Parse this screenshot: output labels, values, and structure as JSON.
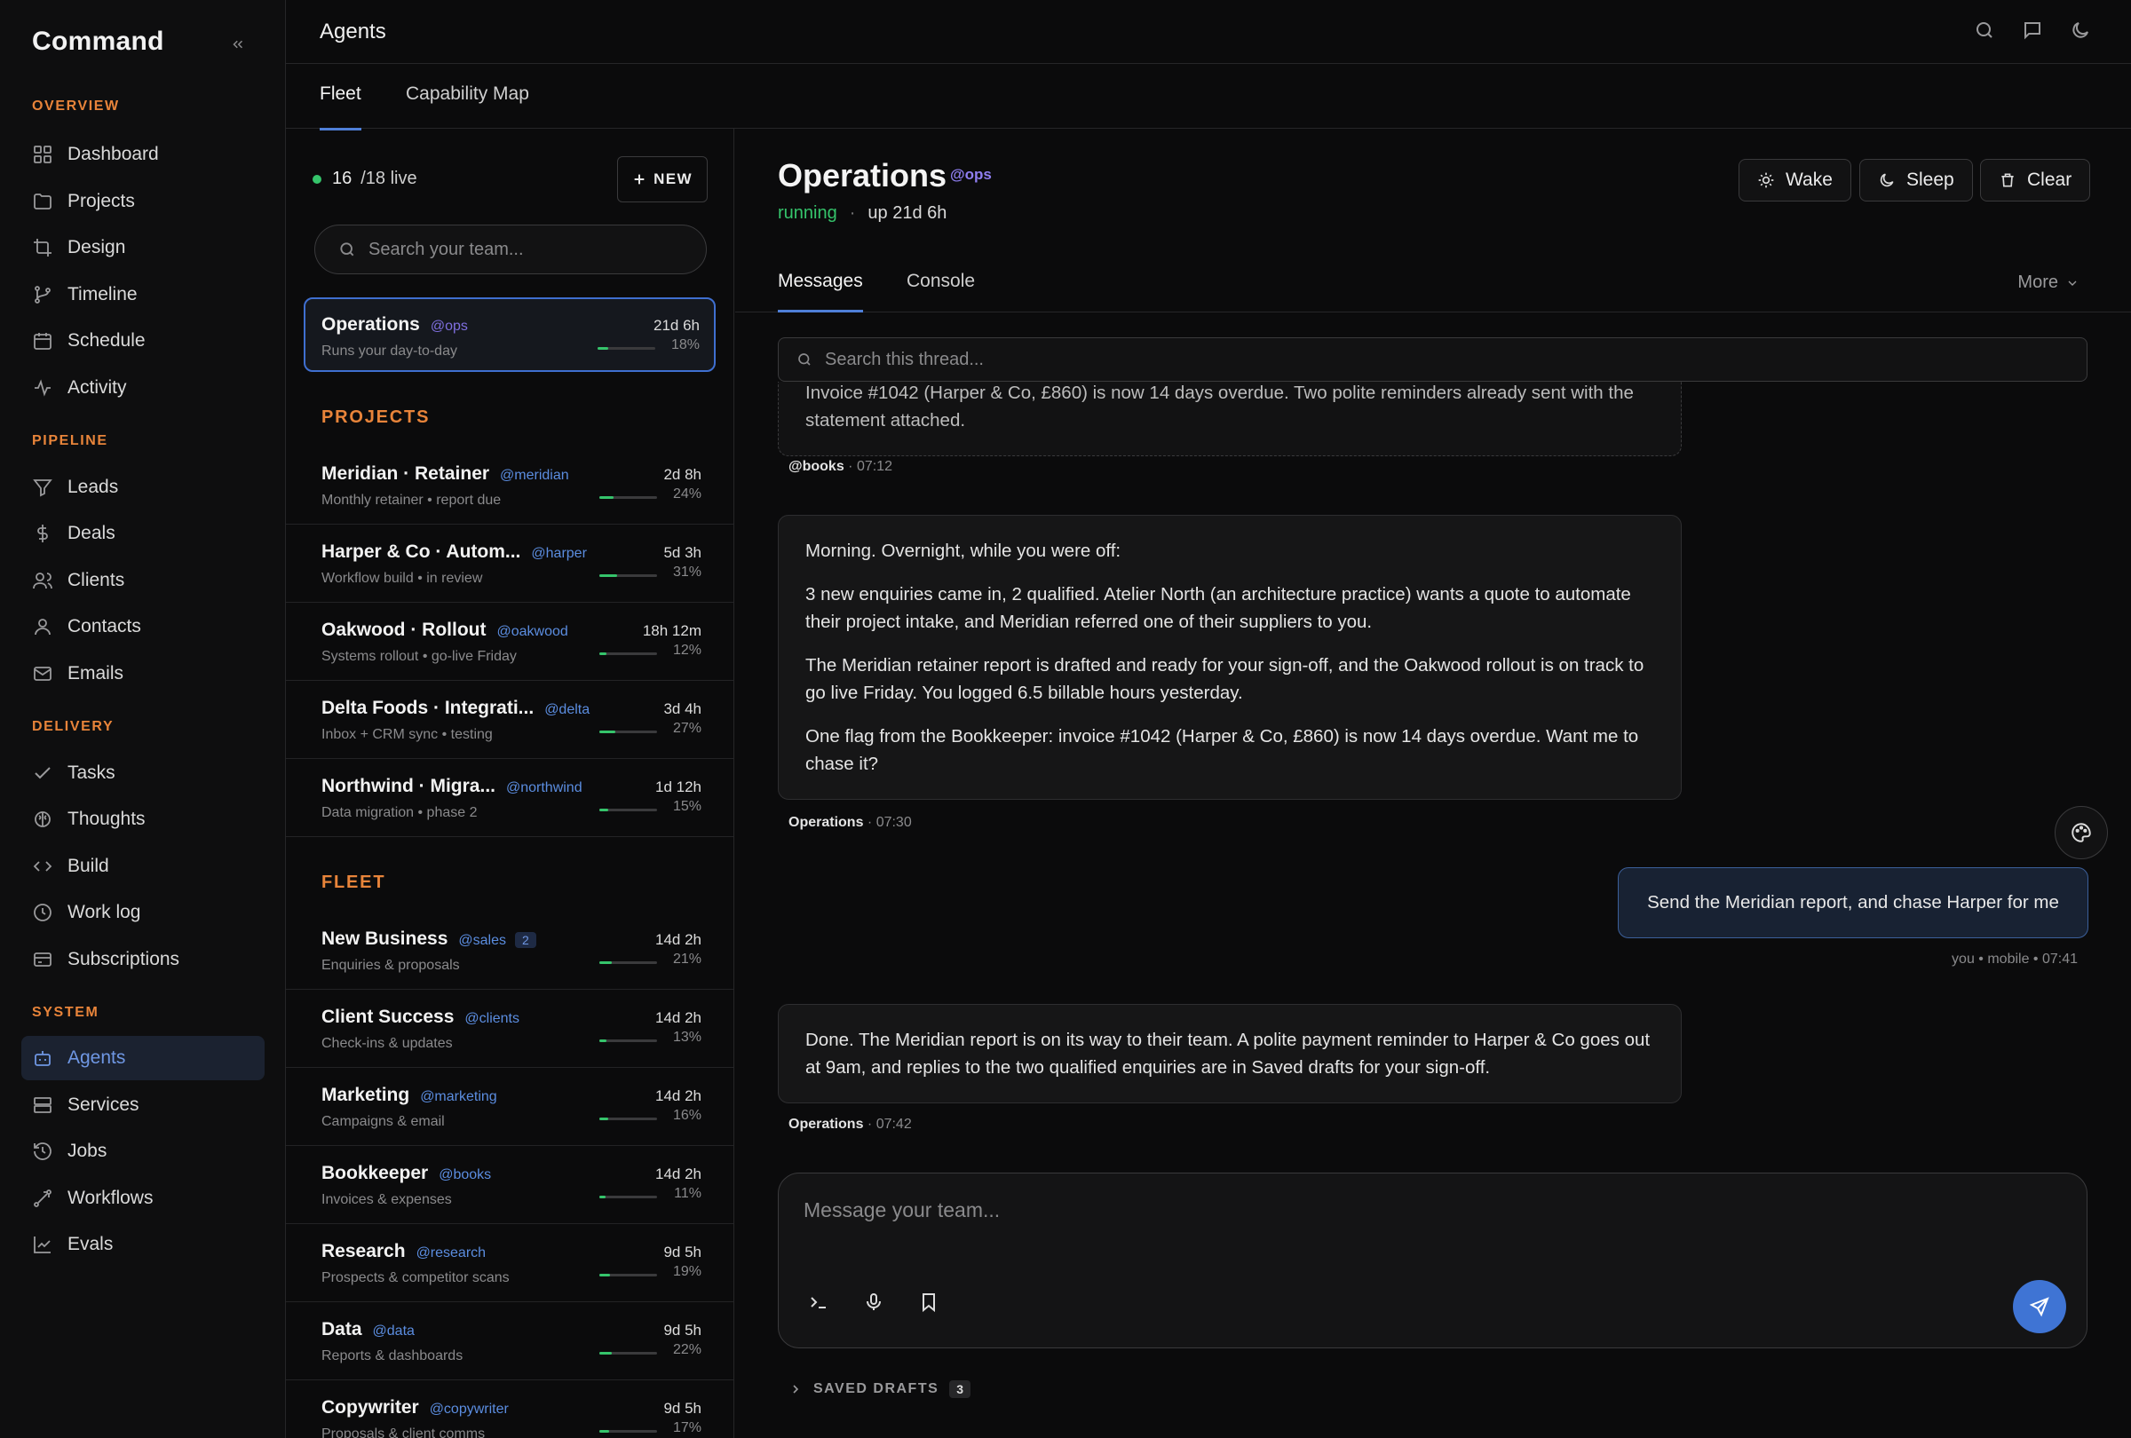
{
  "app": {
    "brand": "Command"
  },
  "sidebar": {
    "sections": [
      {
        "title": "OVERVIEW",
        "items": [
          {
            "label": "Dashboard",
            "icon": "grid-icon"
          },
          {
            "label": "Projects",
            "icon": "folder-icon"
          },
          {
            "label": "Design",
            "icon": "crop-icon"
          },
          {
            "label": "Timeline",
            "icon": "git-branch-icon"
          },
          {
            "label": "Schedule",
            "icon": "calendar-icon"
          },
          {
            "label": "Activity",
            "icon": "activity-icon"
          }
        ]
      },
      {
        "title": "PIPELINE",
        "items": [
          {
            "label": "Leads",
            "icon": "filter-icon"
          },
          {
            "label": "Deals",
            "icon": "dollar-icon"
          },
          {
            "label": "Clients",
            "icon": "users-icon"
          },
          {
            "label": "Contacts",
            "icon": "user-icon"
          },
          {
            "label": "Emails",
            "icon": "mail-icon"
          }
        ]
      },
      {
        "title": "DELIVERY",
        "items": [
          {
            "label": "Tasks",
            "icon": "check-icon"
          },
          {
            "label": "Thoughts",
            "icon": "brain-icon"
          },
          {
            "label": "Build",
            "icon": "code-icon"
          },
          {
            "label": "Work log",
            "icon": "clock-icon"
          },
          {
            "label": "Subscriptions",
            "icon": "card-icon"
          }
        ]
      },
      {
        "title": "SYSTEM",
        "items": [
          {
            "label": "Agents",
            "icon": "bot-icon",
            "active": true
          },
          {
            "label": "Services",
            "icon": "server-icon"
          },
          {
            "label": "Jobs",
            "icon": "history-icon"
          },
          {
            "label": "Workflows",
            "icon": "workflow-icon"
          },
          {
            "label": "Evals",
            "icon": "chart-icon"
          }
        ]
      }
    ]
  },
  "header": {
    "title": "Agents"
  },
  "tabs": [
    "Fleet",
    "Capability Map"
  ],
  "fleet": {
    "live_count": "16",
    "live_total": "/18 live",
    "new_label": "NEW",
    "search_placeholder": "Search your team...",
    "selected": {
      "name": "Operations",
      "handle": "@ops",
      "sub": "Runs your day-to-day",
      "time": "21d 6h",
      "pct": "18%",
      "progress": 0.18
    },
    "projects_title": "PROJECTS",
    "projects": [
      {
        "name": "Meridian · Retainer",
        "handle": "@meridian",
        "sub": "Monthly retainer • report due",
        "time": "2d 8h",
        "pct": "24%",
        "progress": 0.24
      },
      {
        "name": "Harper & Co · Autom...",
        "handle": "@harper",
        "sub": "Workflow build • in review",
        "time": "5d 3h",
        "pct": "31%",
        "progress": 0.31
      },
      {
        "name": "Oakwood · Rollout",
        "handle": "@oakwood",
        "sub": "Systems rollout • go-live Friday",
        "time": "18h 12m",
        "pct": "12%",
        "progress": 0.12
      },
      {
        "name": "Delta Foods · Integrati...",
        "handle": "@delta",
        "sub": "Inbox + CRM sync • testing",
        "time": "3d 4h",
        "pct": "27%",
        "progress": 0.27
      },
      {
        "name": "Northwind · Migra...",
        "handle": "@northwind",
        "sub": "Data migration • phase 2",
        "time": "1d 12h",
        "pct": "15%",
        "progress": 0.15
      }
    ],
    "fleet_title": "FLEET",
    "agents": [
      {
        "name": "New Business",
        "handle": "@sales",
        "badge": "2",
        "sub": "Enquiries & proposals",
        "time": "14d 2h",
        "pct": "21%",
        "progress": 0.21
      },
      {
        "name": "Client Success",
        "handle": "@clients",
        "sub": "Check-ins & updates",
        "time": "14d 2h",
        "pct": "13%",
        "progress": 0.13
      },
      {
        "name": "Marketing",
        "handle": "@marketing",
        "sub": "Campaigns & email",
        "time": "14d 2h",
        "pct": "16%",
        "progress": 0.16
      },
      {
        "name": "Bookkeeper",
        "handle": "@books",
        "sub": "Invoices & expenses",
        "time": "14d 2h",
        "pct": "11%",
        "progress": 0.11
      },
      {
        "name": "Research",
        "handle": "@research",
        "sub": "Prospects & competitor scans",
        "time": "9d 5h",
        "pct": "19%",
        "progress": 0.19
      },
      {
        "name": "Data",
        "handle": "@data",
        "sub": "Reports & dashboards",
        "time": "9d 5h",
        "pct": "22%",
        "progress": 0.22
      },
      {
        "name": "Copywriter",
        "handle": "@copywriter",
        "sub": "Proposals & client comms",
        "time": "9d 5h",
        "pct": "17%",
        "progress": 0.17
      }
    ]
  },
  "detail": {
    "title": "Operations",
    "handle": "@ops",
    "status": "running",
    "uptime": "up 21d 6h",
    "actions": [
      "Wake",
      "Sleep",
      "Clear"
    ],
    "tabs": [
      "Messages",
      "Console"
    ],
    "more_label": "More",
    "search_placeholder": "Search this thread...",
    "messages": [
      {
        "paragraphs": [
          "Invoice #1042 (Harper & Co, £860) is now 14 days overdue. Two polite reminders already sent with the statement attached."
        ],
        "author": "@books",
        "time": " · 07:12"
      },
      {
        "paragraphs": [
          "Morning. Overnight, while you were off:",
          "3 new enquiries came in, 2 qualified. Atelier North (an architecture practice) wants a quote to automate their project intake, and Meridian referred one of their suppliers to you.",
          "The Meridian retainer report is drafted and ready for your sign-off, and the Oakwood rollout is on track to go live Friday. You logged 6.5 billable hours yesterday.",
          "One flag from the Bookkeeper: invoice #1042 (Harper & Co, £860) is now 14 days overdue. Want me to chase it?"
        ],
        "author": "Operations",
        "time": " · 07:30"
      },
      {
        "text": "Send the Meridian report, and chase Harper for me",
        "meta": "you • mobile • 07:41"
      },
      {
        "paragraphs": [
          "Done. The Meridian report is on its way to their team. A polite payment reminder to Harper & Co goes out at 9am, and replies to the two qualified enquiries are in Saved drafts for your sign-off."
        ],
        "author": "Operations",
        "time": " · 07:42"
      }
    ],
    "composer_placeholder": "Message your team...",
    "drafts_label": "SAVED DRAFTS",
    "drafts_count": "3"
  },
  "colors": {
    "accent": "#4f7fd8",
    "orange": "#e8843a",
    "green": "#35c46b",
    "bg": "#0b0b0c"
  }
}
